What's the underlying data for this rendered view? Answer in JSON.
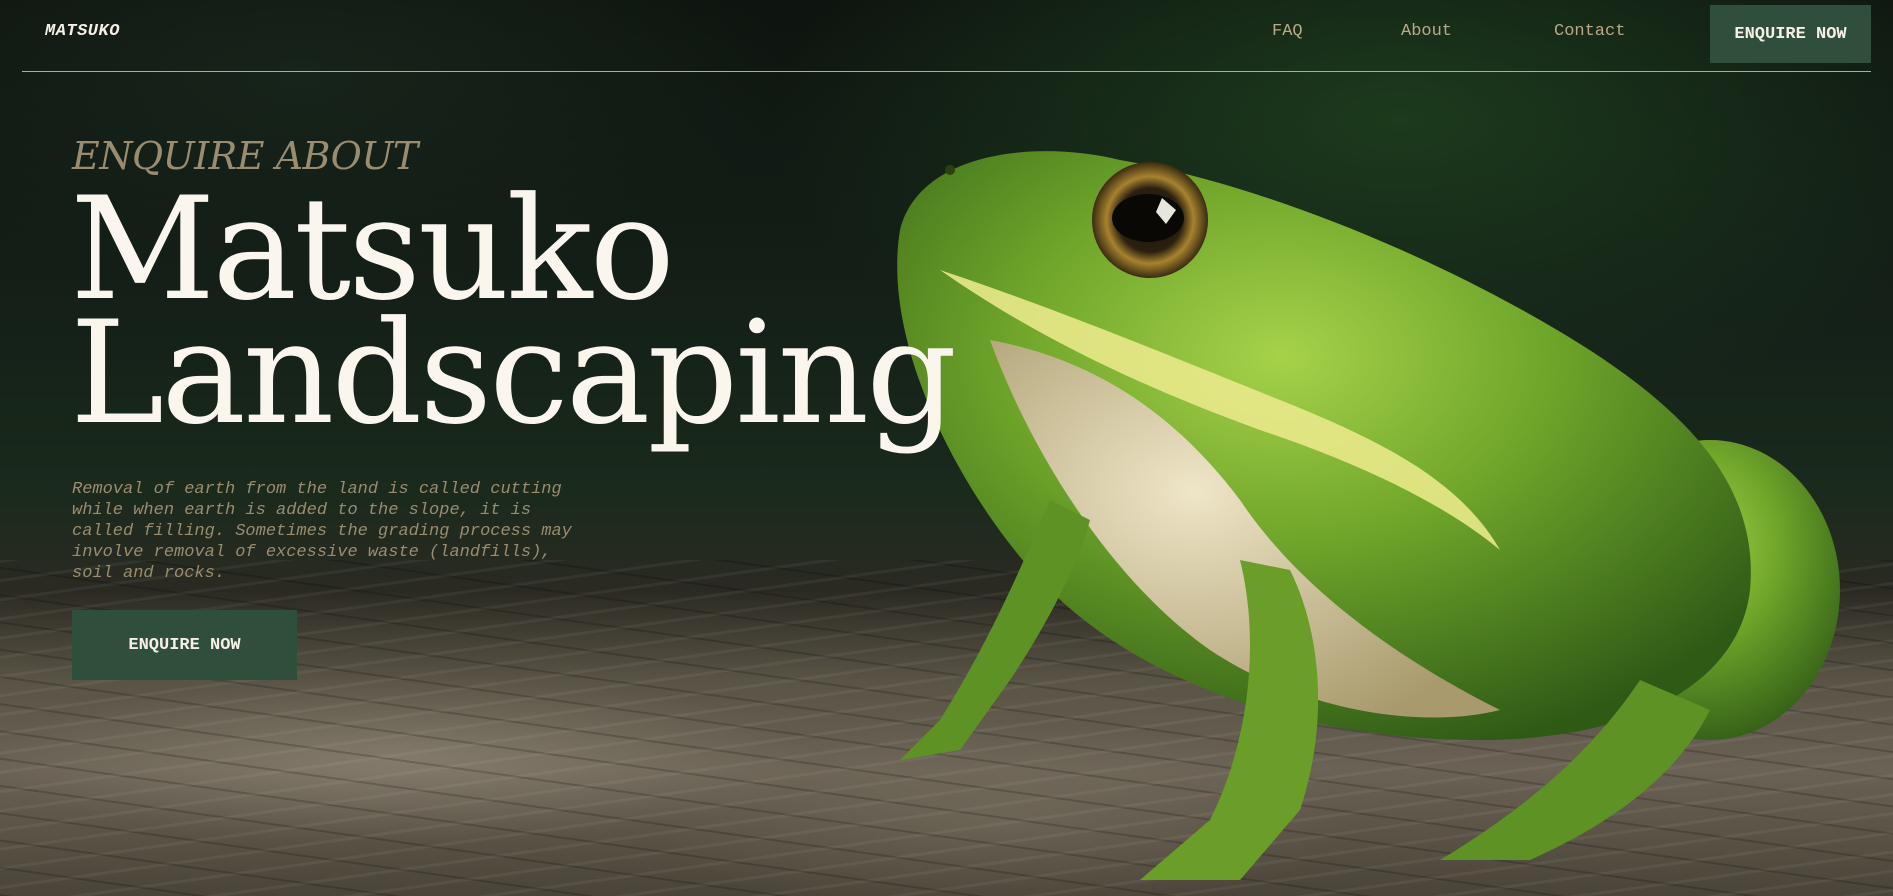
{
  "header": {
    "logo": "MATSUKO",
    "nav": [
      {
        "label": "FAQ"
      },
      {
        "label": "About"
      },
      {
        "label": "Contact"
      }
    ],
    "cta_label": "ENQUIRE NOW"
  },
  "hero": {
    "eyebrow": "ENQUIRE ABOUT",
    "title_line1": "Matsuko",
    "title_line2": "Landscaping",
    "description": "Removal of earth from the land is called cutting while when earth is added to the slope, it is called filling. Sometimes the grading process may involve removal of excessive waste (landfills), soil and rocks.",
    "cta_label": "ENQUIRE NOW",
    "background_image": "frog-on-bark-photo"
  },
  "colors": {
    "accent_button": "#2f4f3c",
    "muted_text": "#9a8c70",
    "nav_text": "#b9a989",
    "headline": "#faf6ee",
    "frog_green": "#7fb23a"
  }
}
